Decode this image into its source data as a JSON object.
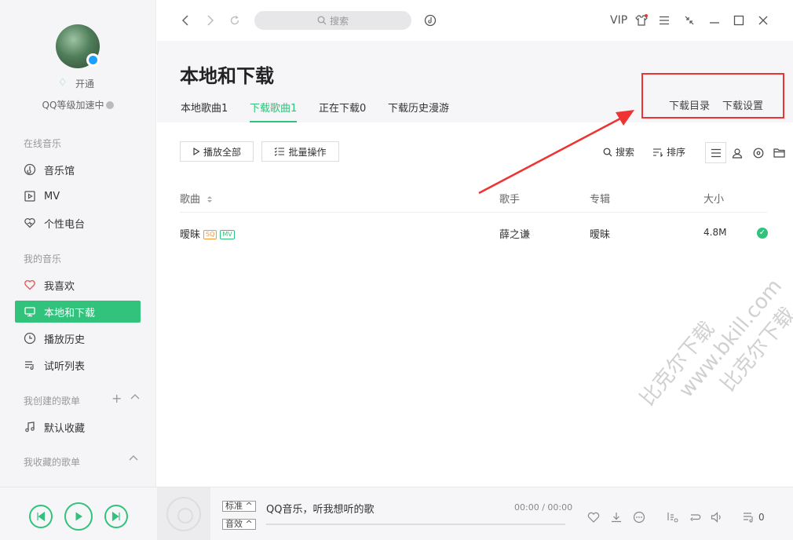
{
  "sidebar": {
    "vip_label": "开通",
    "speedup_label": "QQ等级加速中",
    "sections": {
      "online": "在线音乐",
      "mine": "我的音乐",
      "created": "我创建的歌单",
      "collected": "我收藏的歌单"
    },
    "online_items": [
      "音乐馆",
      "MV",
      "个性电台"
    ],
    "my_items": [
      "我喜欢",
      "本地和下载",
      "播放历史",
      "试听列表"
    ],
    "created_items": [
      "默认收藏"
    ],
    "active_item": "本地和下载"
  },
  "topbar": {
    "search_placeholder": "搜索",
    "vip": "VIP"
  },
  "page": {
    "title": "本地和下载",
    "tabs": [
      "本地歌曲1",
      "下载歌曲1",
      "正在下载0",
      "下载历史漫游"
    ],
    "active_tab": "下载歌曲1",
    "links": [
      "下载目录",
      "下载设置"
    ]
  },
  "toolbar": {
    "play_all": "播放全部",
    "batch": "批量操作",
    "search": "搜索",
    "sort": "排序"
  },
  "table": {
    "headers": [
      "歌曲",
      "歌手",
      "专辑",
      "大小"
    ],
    "rows": [
      {
        "song": "暧昧",
        "tags": [
          "SQ",
          "MV"
        ],
        "artist": "薛之谦",
        "album": "暧昧",
        "size": "4.8M"
      }
    ]
  },
  "player": {
    "quality": "标准",
    "effect": "音效",
    "slogan": "QQ音乐，听我想听的歌",
    "time": "00:00 / 00:00",
    "playlist_count": "0"
  },
  "watermark": {
    "line1": "比克尔下载",
    "line2": "www.bkill.com",
    "line3": "比克尔下载"
  },
  "colors": {
    "accent": "#31c27c",
    "annotation": "#e33333"
  }
}
